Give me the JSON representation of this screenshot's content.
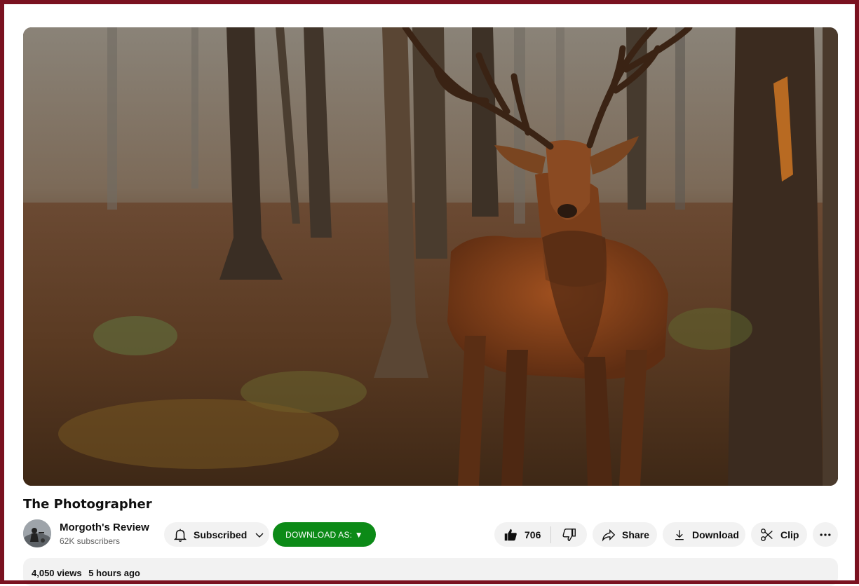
{
  "video": {
    "title": "The Photographer"
  },
  "channel": {
    "name": "Morgoth's Review",
    "subscribers": "62K subscribers"
  },
  "actions": {
    "subscribed_label": "Subscribed",
    "download_as_label": "DOWNLOAD AS: ▼",
    "like_count": "706",
    "share_label": "Share",
    "download_label": "Download",
    "clip_label": "Clip"
  },
  "description": {
    "views": "4,050 views",
    "posted": "5 hours ago"
  },
  "colors": {
    "frame": "#7a1220",
    "download_as_bg": "#0c8a17",
    "pill_bg": "#f2f2f2"
  },
  "icons": [
    "bell-icon",
    "chevron-down-icon",
    "thumbs-up-icon",
    "thumbs-down-icon",
    "share-icon",
    "download-icon",
    "scissors-icon",
    "more-icon"
  ]
}
